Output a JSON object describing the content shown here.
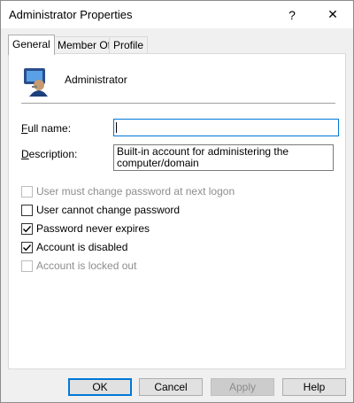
{
  "window": {
    "title": "Administrator Properties",
    "help_glyph": "?",
    "close_glyph": "✕"
  },
  "tabs": [
    {
      "label": "General",
      "active": true
    },
    {
      "label": "Member Of",
      "active": false
    },
    {
      "label": "Profile",
      "active": false
    }
  ],
  "account": {
    "name": "Administrator"
  },
  "fields": {
    "full_name_label": "Full name:",
    "full_name_value": "",
    "description_label": "Description:",
    "description_value": "Built-in account for administering the computer/domain"
  },
  "checkboxes": [
    {
      "label": "User must change password at next logon",
      "checked": false,
      "enabled": false
    },
    {
      "label": "User cannot change password",
      "checked": false,
      "enabled": true
    },
    {
      "label": "Password never expires",
      "checked": true,
      "enabled": true
    },
    {
      "label": "Account is disabled",
      "checked": true,
      "enabled": true
    },
    {
      "label": "Account is locked out",
      "checked": false,
      "enabled": false
    }
  ],
  "buttons": {
    "ok": "OK",
    "cancel": "Cancel",
    "apply": "Apply",
    "help": "Help"
  },
  "colors": {
    "accent": "#0078d7",
    "disabled_text": "#8d8d8d"
  }
}
